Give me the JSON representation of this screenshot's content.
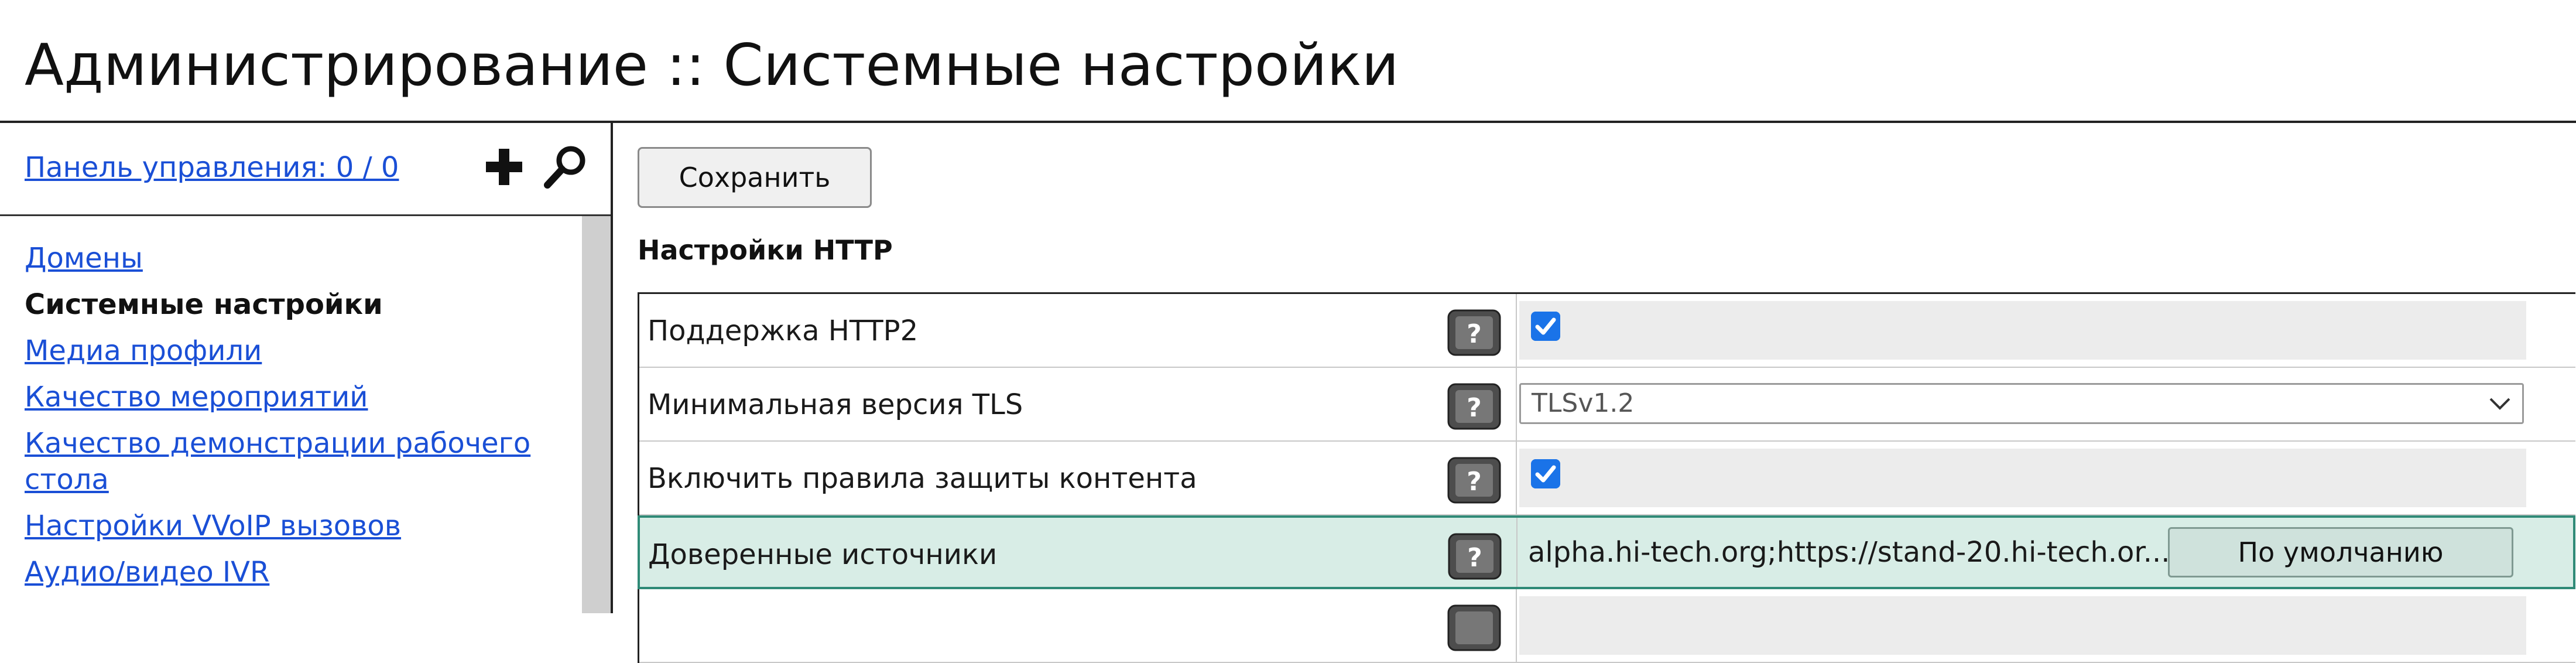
{
  "page": {
    "title": "Администрирование :: Системные настройки"
  },
  "sidebar": {
    "panel_link": "Панель управления: 0 / 0",
    "add_icon": "plus-icon",
    "search_icon": "magnifier-icon",
    "items": [
      {
        "label": "Домены",
        "active": false
      },
      {
        "label": "Системные настройки",
        "active": true
      },
      {
        "label": "Медиа профили",
        "active": false
      },
      {
        "label": "Качество мероприятий",
        "active": false
      },
      {
        "label": "Качество демонстрации рабочего стола",
        "active": false
      },
      {
        "label": "Настройки VVoIP вызовов",
        "active": false
      },
      {
        "label": "Аудио/видео IVR",
        "active": false
      }
    ]
  },
  "toolbar": {
    "save_label": "Сохранить"
  },
  "section": {
    "title": "Настройки HTTP"
  },
  "settings": [
    {
      "label": "Поддержка HTTP2",
      "type": "checkbox",
      "checked": true
    },
    {
      "label": "Минимальная версия TLS",
      "type": "select",
      "value": "TLSv1.2"
    },
    {
      "label": "Включить правила защиты контента",
      "type": "checkbox",
      "checked": true
    },
    {
      "label": "Доверенные источники",
      "type": "text",
      "value": "alpha.hi-tech.org;https://stand-20.hi-tech.or...",
      "default_label": "По умолчанию",
      "highlighted": true
    }
  ],
  "colors": {
    "link": "#1a4fd6",
    "accent_checkbox": "#1a73e8",
    "highlight_row_bg": "#d8ede6",
    "highlight_row_border": "#2f8a77"
  }
}
